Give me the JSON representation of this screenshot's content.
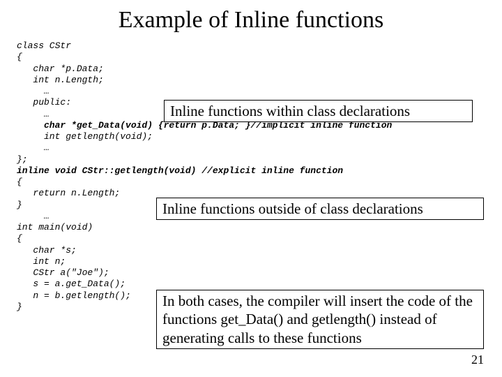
{
  "title": "Example of Inline functions",
  "code": {
    "l01": "class CStr",
    "l02": "{",
    "l03": "   char *p.Data;",
    "l04": "   int n.Length;",
    "l05": "     …",
    "l06": "   public:",
    "l07": "     …",
    "l08a": "     char *get_Data(void) {return p.Data; }",
    "l08b": "//implicit inline function",
    "l09": "     int getlength(void);",
    "l10": "     …",
    "l11": "};",
    "l12": "",
    "l13a": "inline void CStr::getlength(void) ",
    "l13b": "//explicit inline function",
    "l14": "{",
    "l15": "   return n.Length;",
    "l16": "}",
    "l17": "     …",
    "l18": "",
    "l19": "int main(void)",
    "l20": "{",
    "l21": "   char *s;",
    "l22": "   int n;",
    "l23": "   CStr a(\"Joe\");",
    "l24": "   s = a.get_Data();",
    "l25": "   n = b.getlength();",
    "l26": "}"
  },
  "callouts": {
    "c1": "Inline functions within class declarations",
    "c2": "Inline functions outside of class declarations",
    "c3": "In both cases, the compiler will insert the code of the functions get_Data() and getlength() instead of generating calls to these functions"
  },
  "page": "21"
}
